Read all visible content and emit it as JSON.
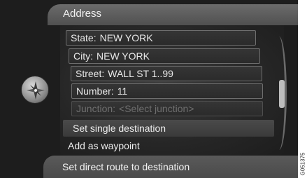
{
  "header": {
    "title": "Address"
  },
  "fields": [
    {
      "label": "State:",
      "value": "NEW YORK"
    },
    {
      "label": "City:",
      "value": "NEW YORK"
    },
    {
      "label": "Street:",
      "value": "WALL ST 1..99"
    },
    {
      "label": "Number:",
      "value": "11"
    },
    {
      "label": "Junction:",
      "value": "<Select junction>"
    }
  ],
  "actions": {
    "set_single_destination": "Set single destination",
    "add_as_waypoint": "Add as waypoint",
    "set_direct_route": "Set direct route to destination"
  },
  "side_code": "G051375",
  "icons": {
    "compass": "compass-icon"
  },
  "colors": {
    "background": "#1d1d1d",
    "text": "#eeeeee",
    "disabled_text": "#6f6f6f"
  }
}
